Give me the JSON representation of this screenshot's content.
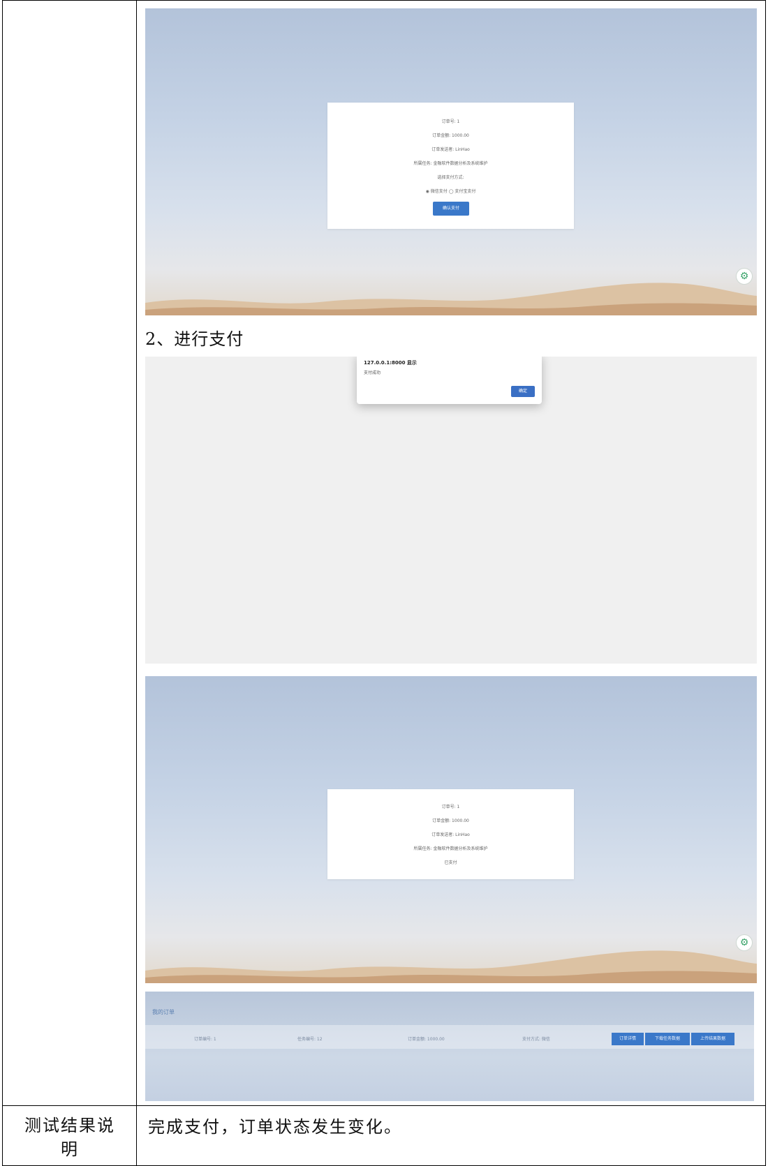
{
  "step2_caption": "2、进行支付",
  "payment_page": {
    "order_no": "订单号: 1",
    "order_amount": "订单金额: 1000.00",
    "order_sender": "订单发送者: LinHao",
    "product": "所属任务: 金融软件数据分析及系统维护",
    "choose_method": "选择支付方式:",
    "methods": "◉ 微信支付 ◯ 支付宝支付",
    "confirm_button": "确认支付"
  },
  "alert_dialog": {
    "title": "127.0.0.1:8000 显示",
    "message": "支付成功",
    "ok_button": "确定"
  },
  "paid_page": {
    "order_no": "订单号: 1",
    "order_amount": "订单金额: 1000.00",
    "order_sender": "订单发送者: LinHao",
    "product": "所属任务: 金融软件数据分析及系统维护",
    "status": "已支付"
  },
  "orders_panel": {
    "title": "我的订单",
    "order_id": "订单编号: 1",
    "task_id": "任务编号: 12",
    "amount": "订单金额: 1000.00",
    "pay_method": "支付方式: 微信",
    "buttons": [
      "订单详情",
      "下载任务数据",
      "上传结果数据"
    ]
  },
  "result_label": "测试结果说明",
  "result_text": "完成支付，订单状态发生变化。",
  "colors": {
    "accent_blue": "#3a78c9",
    "gear_green": "#3aa36a"
  }
}
